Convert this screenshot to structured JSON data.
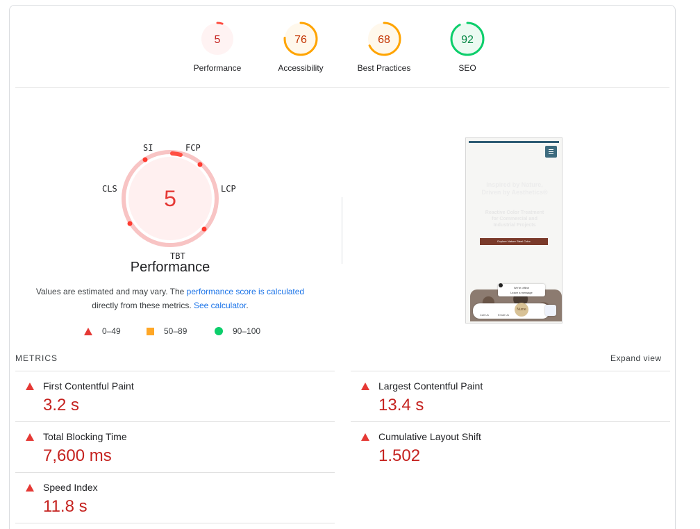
{
  "gauges": [
    {
      "label": "Performance",
      "score": "5",
      "value": 5,
      "stroke": "#ff4e42",
      "fill": "#fff3f3",
      "text": "#c5221f"
    },
    {
      "label": "Accessibility",
      "score": "76",
      "value": 76,
      "stroke": "#ffa400",
      "fill": "#fff8ec",
      "text": "#c33300"
    },
    {
      "label": "Best Practices",
      "score": "68",
      "value": 68,
      "stroke": "#ffa400",
      "fill": "#fff8ec",
      "text": "#c33300"
    },
    {
      "label": "SEO",
      "score": "92",
      "value": 92,
      "stroke": "#0cce6b",
      "fill": "#ecfaf2",
      "text": "#018642"
    }
  ],
  "performance": {
    "score": "5",
    "title": "Performance",
    "metric_labels": {
      "si": "SI",
      "fcp": "FCP",
      "lcp": "LCP",
      "tbt": "TBT",
      "cls": "CLS"
    },
    "note_prefix": "Values are estimated and may vary. The ",
    "note_link1": "performance score is calculated",
    "note_middle": "directly from these metrics. ",
    "note_link2": "See calculator",
    "note_suffix": "."
  },
  "legend": [
    {
      "icon": "red-triangle-icon",
      "range": "0–49"
    },
    {
      "icon": "orange-square-icon",
      "range": "50–89"
    },
    {
      "icon": "green-circle-icon",
      "range": "90–100"
    }
  ],
  "screenshot": {
    "headline": "Inspired by Nature, Driven by Aesthetics®",
    "subhead": "Reactive Color Treatment for Commercial and Industrial Projects",
    "button": "Explore Nature Steel Color",
    "chat_line1": "We're offline",
    "chat_line2": "Leave a message",
    "nav_call": "Call Us",
    "nav_email": "Email Us",
    "badge": "Nume"
  },
  "metrics": {
    "title": "METRICS",
    "expand_label": "Expand view",
    "items": [
      {
        "name": "First Contentful Paint",
        "value": "3.2 s"
      },
      {
        "name": "Largest Contentful Paint",
        "value": "13.4 s"
      },
      {
        "name": "Total Blocking Time",
        "value": "7,600 ms"
      },
      {
        "name": "Cumulative Layout Shift",
        "value": "1.502"
      },
      {
        "name": "Speed Index",
        "value": "11.8 s"
      }
    ]
  },
  "colors": {
    "fail": "#e53935",
    "average": "#ffa726",
    "pass": "#0cce6b",
    "link": "#1a73e8",
    "value_red": "#c5221f"
  }
}
